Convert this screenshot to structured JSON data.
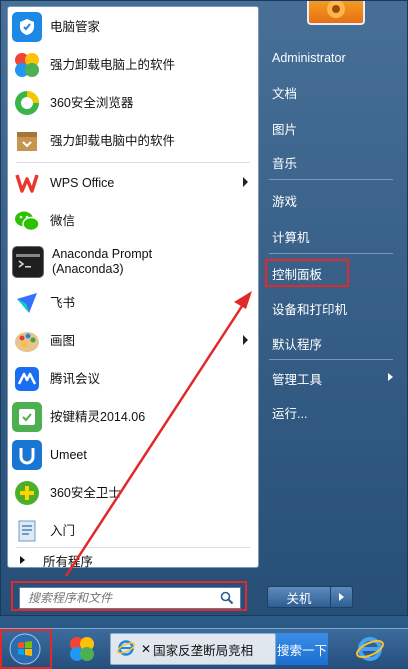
{
  "programs": [
    {
      "label": "电脑管家",
      "icon": "pc-manager-icon",
      "color": "#1e88e5"
    },
    {
      "label": "强力卸载电脑上的软件",
      "icon": "uninstall-colorful-icon",
      "color": "#f7a81b"
    },
    {
      "label": "360安全浏览器",
      "icon": "360-browser-icon",
      "color": "#39b54a"
    },
    {
      "label": "强力卸载电脑中的软件",
      "icon": "uninstall-box-icon",
      "color": "#c6954f"
    },
    {
      "label": "WPS Office",
      "icon": "wps-icon",
      "color": "#e8382d"
    },
    {
      "label": "微信",
      "icon": "wechat-icon",
      "color": "#2dc100"
    },
    {
      "label": "Anaconda Prompt\n(Anaconda3)",
      "icon": "terminal-icon",
      "color": "#1f1f1f"
    },
    {
      "label": "飞书",
      "icon": "feishu-icon",
      "color": "#3370ff"
    },
    {
      "label": "画图",
      "icon": "paint-icon",
      "color": "#d4a24c"
    },
    {
      "label": "腾讯会议",
      "icon": "tencent-meeting-icon",
      "color": "#1a6ef2"
    },
    {
      "label": "按键精灵2014.06",
      "icon": "keysprite-icon",
      "color": "#4caf50"
    },
    {
      "label": "Umeet",
      "icon": "umeet-icon",
      "color": "#1976d2"
    },
    {
      "label": "360安全卫士",
      "icon": "360-safe-icon",
      "color": "#4caf2a"
    },
    {
      "label": "入门",
      "icon": "getting-started-icon",
      "color": "#6b9ec9"
    }
  ],
  "all_programs": "所有程序",
  "search_placeholder": "搜索程序和文件",
  "right": {
    "user": "Administrator",
    "documents": "文档",
    "pictures": "图片",
    "music": "音乐",
    "games": "游戏",
    "computer": "计算机",
    "control_panel": "控制面板",
    "devices_printers": "设备和打印机",
    "default_programs": "默认程序",
    "admin_tools": "管理工具",
    "run": "运行..."
  },
  "shutdown": "关机",
  "taskbar": {
    "ie_title": "国家反垄断局竞相",
    "search": "搜索一下"
  },
  "colors": {
    "highlight": "#e3282a",
    "accent": "#2b5d8f"
  }
}
